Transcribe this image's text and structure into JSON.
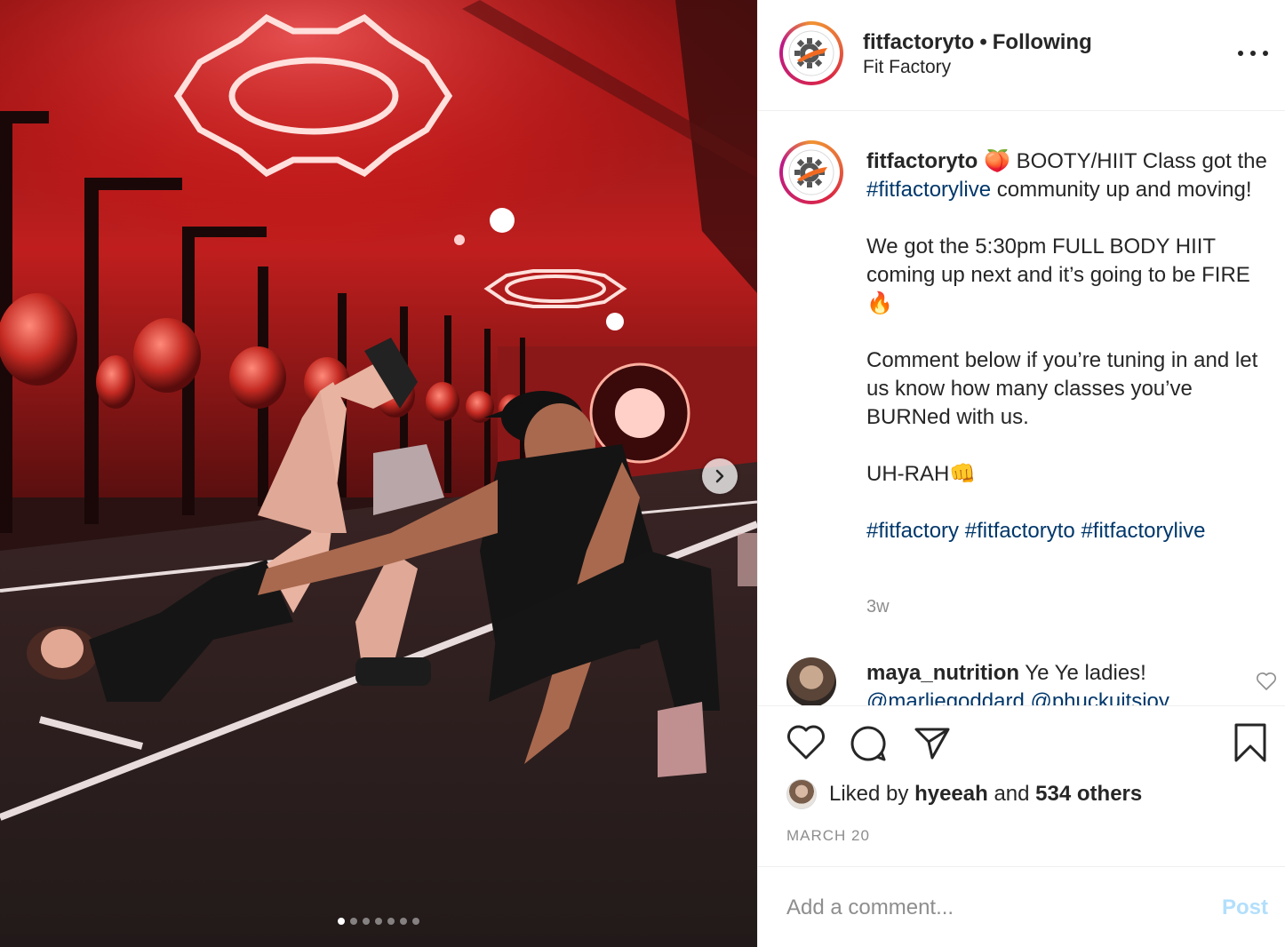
{
  "post": {
    "username": "fitfactoryto",
    "separator": "•",
    "follow_status": "Following",
    "location": "Fit Factory"
  },
  "photo": {
    "carousel_count": 7,
    "carousel_active_index": 0
  },
  "caption": {
    "username": "fitfactoryto",
    "part1": " 🍑 BOOTY/HIIT Class got the ",
    "hashtag1": "#fitfactorylive",
    "part2": " community up and moving!\n\nWe got the 5:30pm FULL BODY HIIT coming up next and it’s going to be FIRE🔥\n\nComment below if you’re tuning in and let us know how many classes you’ve BURNed with us.\n\nUH-RAH👊\n\n",
    "tags": [
      "#fitfactory",
      "#fitfactoryto",
      "#fitfactorylive"
    ],
    "time": "3w"
  },
  "comment": {
    "username": "maya_nutrition",
    "text": " Ye Ye ladies!",
    "mentions": "@marliegoddard @phuckuitsjoy"
  },
  "actions": {
    "like_icon": "heart-icon",
    "comment_icon": "speech-bubble-icon",
    "share_icon": "paper-plane-icon",
    "save_icon": "bookmark-icon"
  },
  "likes": {
    "prefix": "Liked by ",
    "user": "hyeeah",
    "middle": " and ",
    "others": "534 others"
  },
  "date": "MARCH 20",
  "add_comment": {
    "placeholder": "Add a comment...",
    "post_label": "Post"
  },
  "colors": {
    "link": "#00376b",
    "muted": "#8e8e8e",
    "post_disabled": "#b2dffc",
    "neon": "#ff3b3b"
  }
}
